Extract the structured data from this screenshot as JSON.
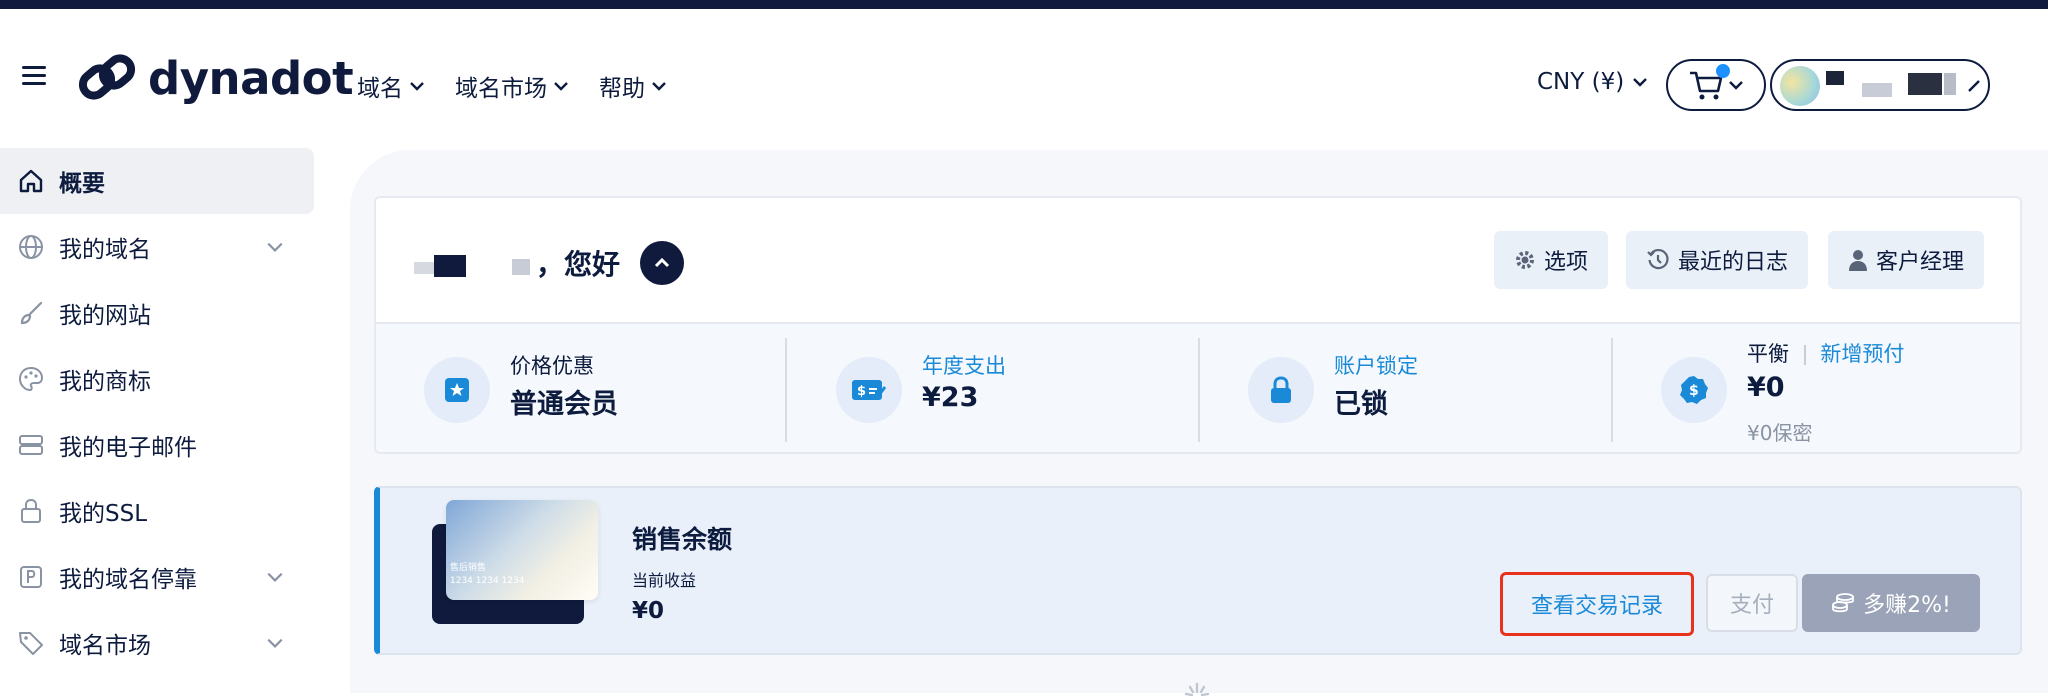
{
  "header": {
    "logo_text": "dynadot",
    "nav": [
      {
        "label": "域名"
      },
      {
        "label": "域名市场"
      },
      {
        "label": "帮助"
      }
    ],
    "currency": "CNY (¥)"
  },
  "sidebar": {
    "items": [
      {
        "label": "概要",
        "icon": "home-icon"
      },
      {
        "label": "我的域名",
        "icon": "globe-icon"
      },
      {
        "label": "我的网站",
        "icon": "brush-icon"
      },
      {
        "label": "我的商标",
        "icon": "palette-icon"
      },
      {
        "label": "我的电子邮件",
        "icon": "server-icon"
      },
      {
        "label": "我的SSL",
        "icon": "lock-icon"
      },
      {
        "label": "我的域名停靠",
        "icon": "parking-icon"
      },
      {
        "label": "域名市场",
        "icon": "tag-icon"
      }
    ]
  },
  "welcome": {
    "greeting": "，您好",
    "buttons": {
      "options": "选项",
      "recent_log": "最近的日志",
      "account_manager": "客户经理"
    }
  },
  "stats": {
    "pricing_label": "价格优惠",
    "pricing_value": "普通会员",
    "spend_label": "年度支出",
    "spend_value": "¥23",
    "lock_label": "账户锁定",
    "lock_value": "已锁",
    "balance_label": "平衡",
    "balance_link": "新增预付",
    "balance_value": "¥0",
    "balance_sub": "¥0保密"
  },
  "sales": {
    "card_text_1": "售后销售",
    "card_text_2": "1234 1234 1234",
    "title": "销售余额",
    "label": "当前收益",
    "value": "¥0",
    "view_transactions": "查看交易记录",
    "pay": "支付",
    "earn_more": "多赚2%!"
  },
  "colors": {
    "brand_dark": "#0f1a3c",
    "link_blue": "#1a8ad8",
    "highlight_red": "#e8321c"
  }
}
